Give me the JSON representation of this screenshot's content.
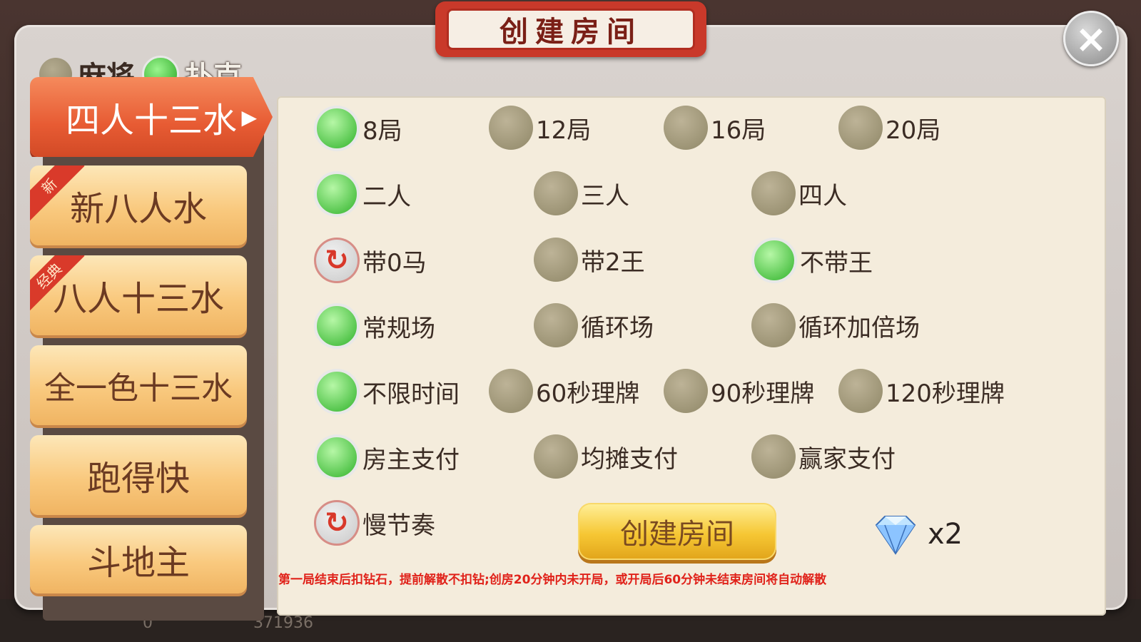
{
  "title": "创建房间",
  "close_label": "×",
  "top_tabs": [
    {
      "label": "麻将",
      "selected": false
    },
    {
      "label": "扑克",
      "selected": true
    }
  ],
  "games": [
    {
      "label": "四人十三水",
      "active": true,
      "ribbon": ""
    },
    {
      "label": "新八人水",
      "active": false,
      "ribbon": "新"
    },
    {
      "label": "八人十三水",
      "active": false,
      "ribbon": "经典"
    },
    {
      "label": "全一色十三水",
      "active": false,
      "ribbon": ""
    },
    {
      "label": "跑得快",
      "active": false,
      "ribbon": ""
    },
    {
      "label": "斗地主",
      "active": false,
      "ribbon": ""
    }
  ],
  "options": {
    "rounds": [
      "8局",
      "12局",
      "16局",
      "20局"
    ],
    "players": [
      "二人",
      "三人",
      "四人"
    ],
    "extras": [
      "带0马",
      "带2王",
      "不带王"
    ],
    "modes": [
      "常规场",
      "循环场",
      "循环加倍场"
    ],
    "time": [
      "不限时间",
      "60秒理牌",
      "90秒理牌",
      "120秒理牌"
    ],
    "pay": [
      "房主支付",
      "均摊支付",
      "赢家支付"
    ],
    "speed": [
      "慢节奏"
    ]
  },
  "create_button": "创建房间",
  "cost": "x2",
  "notice": "第一局结束后扣钻石，提前解散不扣钻;创房20分钟内未开局，或开局后60分钟未结束房间将自动解散",
  "bottom_stats": [
    "0",
    "371936"
  ],
  "colors": {
    "accent_red": "#e75b33",
    "radio_on": "#2fb22a",
    "notice": "#e0221a"
  }
}
